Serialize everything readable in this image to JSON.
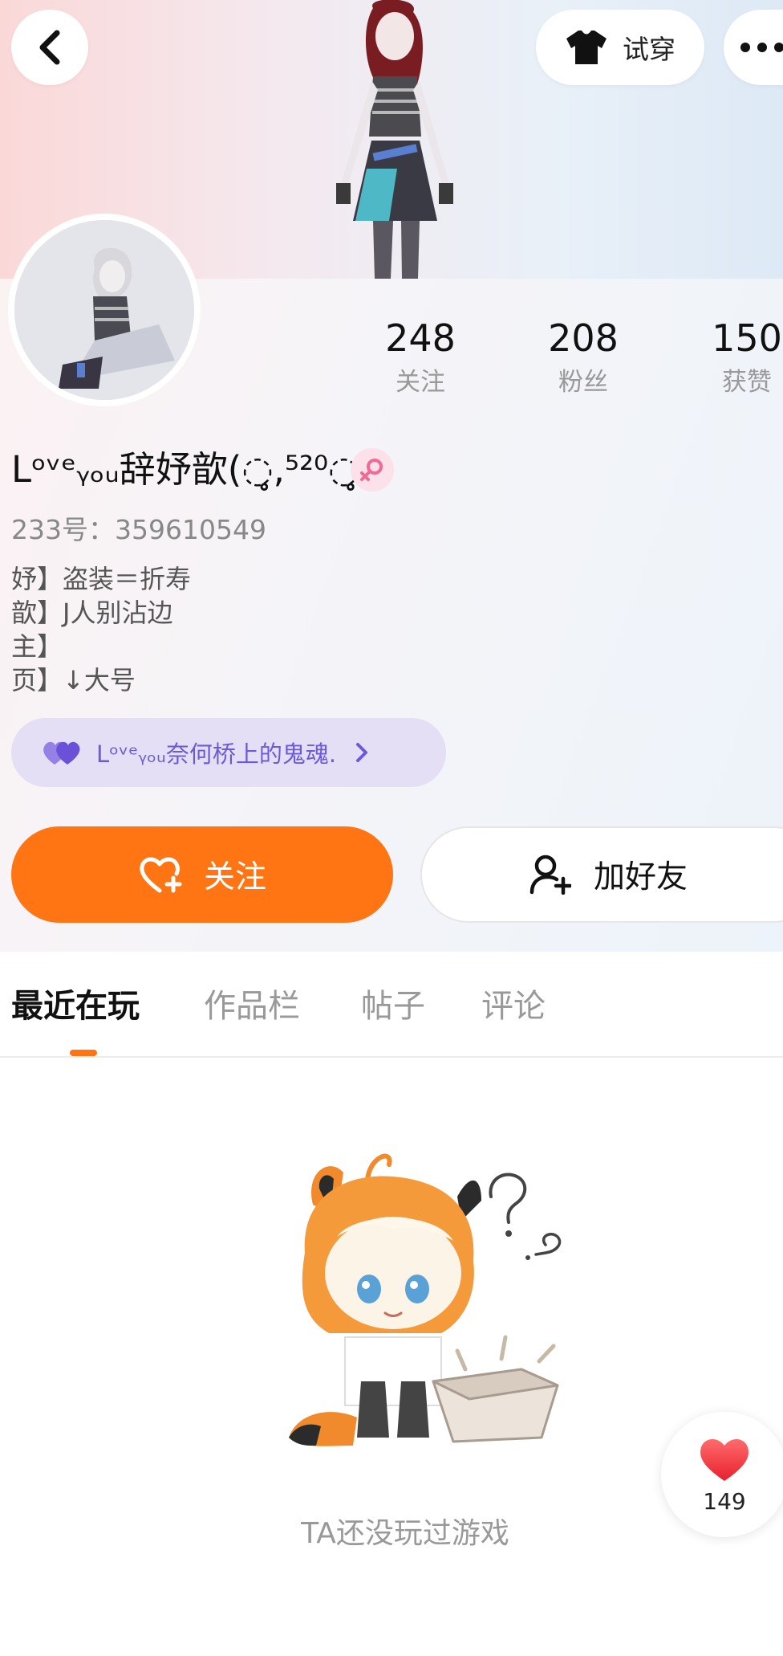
{
  "header": {
    "try_on_label": "试穿",
    "icons": {
      "back": "chevron-left-icon",
      "try_on": "shirt-icon",
      "more": "more-dots-icon"
    }
  },
  "stats": [
    {
      "value": "248",
      "label": "关注"
    },
    {
      "value": "208",
      "label": "粉丝"
    },
    {
      "value": "150",
      "label": "获赞"
    }
  ],
  "profile": {
    "nickname": "Lᵒᵛᵉᵧₒᵤ辞妤歆(◌̥̥,⁵²⁰◌̥̥",
    "gender": "female",
    "uid": "233号：359610549",
    "bio": [
      "妤】盗装＝折寿",
      "歆】J人别沾边",
      "主】",
      "页】↓大号"
    ]
  },
  "guild": {
    "name": "Lᵒᵛᵉᵧₒᵤ奈何桥上的鬼魂."
  },
  "actions": {
    "follow_label": "关注",
    "add_friend_label": "加好友"
  },
  "tabs": [
    {
      "label": "最近在玩",
      "active": true
    },
    {
      "label": "作品栏",
      "active": false
    },
    {
      "label": "帖子",
      "active": false
    },
    {
      "label": "评论",
      "active": false
    }
  ],
  "empty_state": {
    "message": "TA还没玩过游戏"
  },
  "like_widget": {
    "count": "149"
  },
  "colors": {
    "accent": "#ff7514",
    "guild_text": "#6d5bd6",
    "gender_badge": "#f06b93"
  }
}
